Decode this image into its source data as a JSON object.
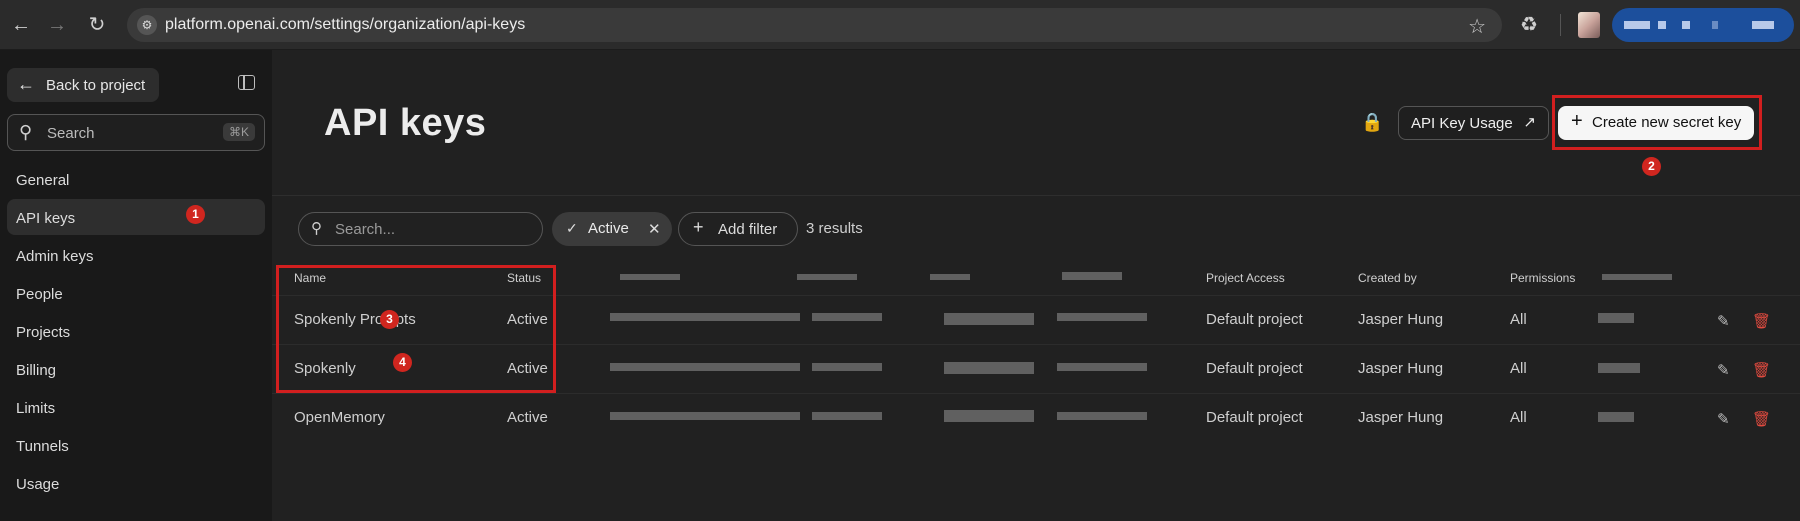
{
  "browser": {
    "url": "platform.openai.com/settings/organization/api-keys",
    "back_icon": "arrow-left-icon",
    "forward_icon": "arrow-right-icon",
    "reload_icon": "reload-icon",
    "bookmark_icon": "star-icon",
    "extensions_icon": "puzzle-icon"
  },
  "sidebar": {
    "back_label": "Back to project",
    "search_placeholder": "Search",
    "search_shortcut": "⌘K",
    "items": [
      {
        "label": "General",
        "active": false
      },
      {
        "label": "API keys",
        "active": true
      },
      {
        "label": "Admin keys",
        "active": false
      },
      {
        "label": "People",
        "active": false
      },
      {
        "label": "Projects",
        "active": false
      },
      {
        "label": "Billing",
        "active": false
      },
      {
        "label": "Limits",
        "active": false
      },
      {
        "label": "Tunnels",
        "active": false
      },
      {
        "label": "Usage",
        "active": false
      }
    ]
  },
  "header": {
    "title": "API keys",
    "usage_button": "API Key Usage",
    "create_button": "Create new secret key"
  },
  "filters": {
    "search_placeholder": "Search...",
    "active_chip": "Active",
    "add_filter": "Add filter",
    "results": "3 results"
  },
  "table": {
    "columns": [
      "Name",
      "Status",
      "Project Access",
      "Created by",
      "Permissions"
    ],
    "rows": [
      {
        "name": "Spokenly Prompts",
        "status": "Active",
        "project": "Default project",
        "created_by": "Jasper Hung",
        "permissions": "All"
      },
      {
        "name": "Spokenly",
        "status": "Active",
        "project": "Default project",
        "created_by": "Jasper Hung",
        "permissions": "All"
      },
      {
        "name": "OpenMemory",
        "status": "Active",
        "project": "Default project",
        "created_by": "Jasper Hung",
        "permissions": "All"
      }
    ]
  },
  "annotations": {
    "badges": [
      "1",
      "2",
      "3",
      "4"
    ],
    "color": "#d21f1f"
  },
  "colors": {
    "background": "#212121",
    "sidebar": "#191919",
    "accent_button": "#f6f6f6",
    "delete": "#e04a3f"
  }
}
